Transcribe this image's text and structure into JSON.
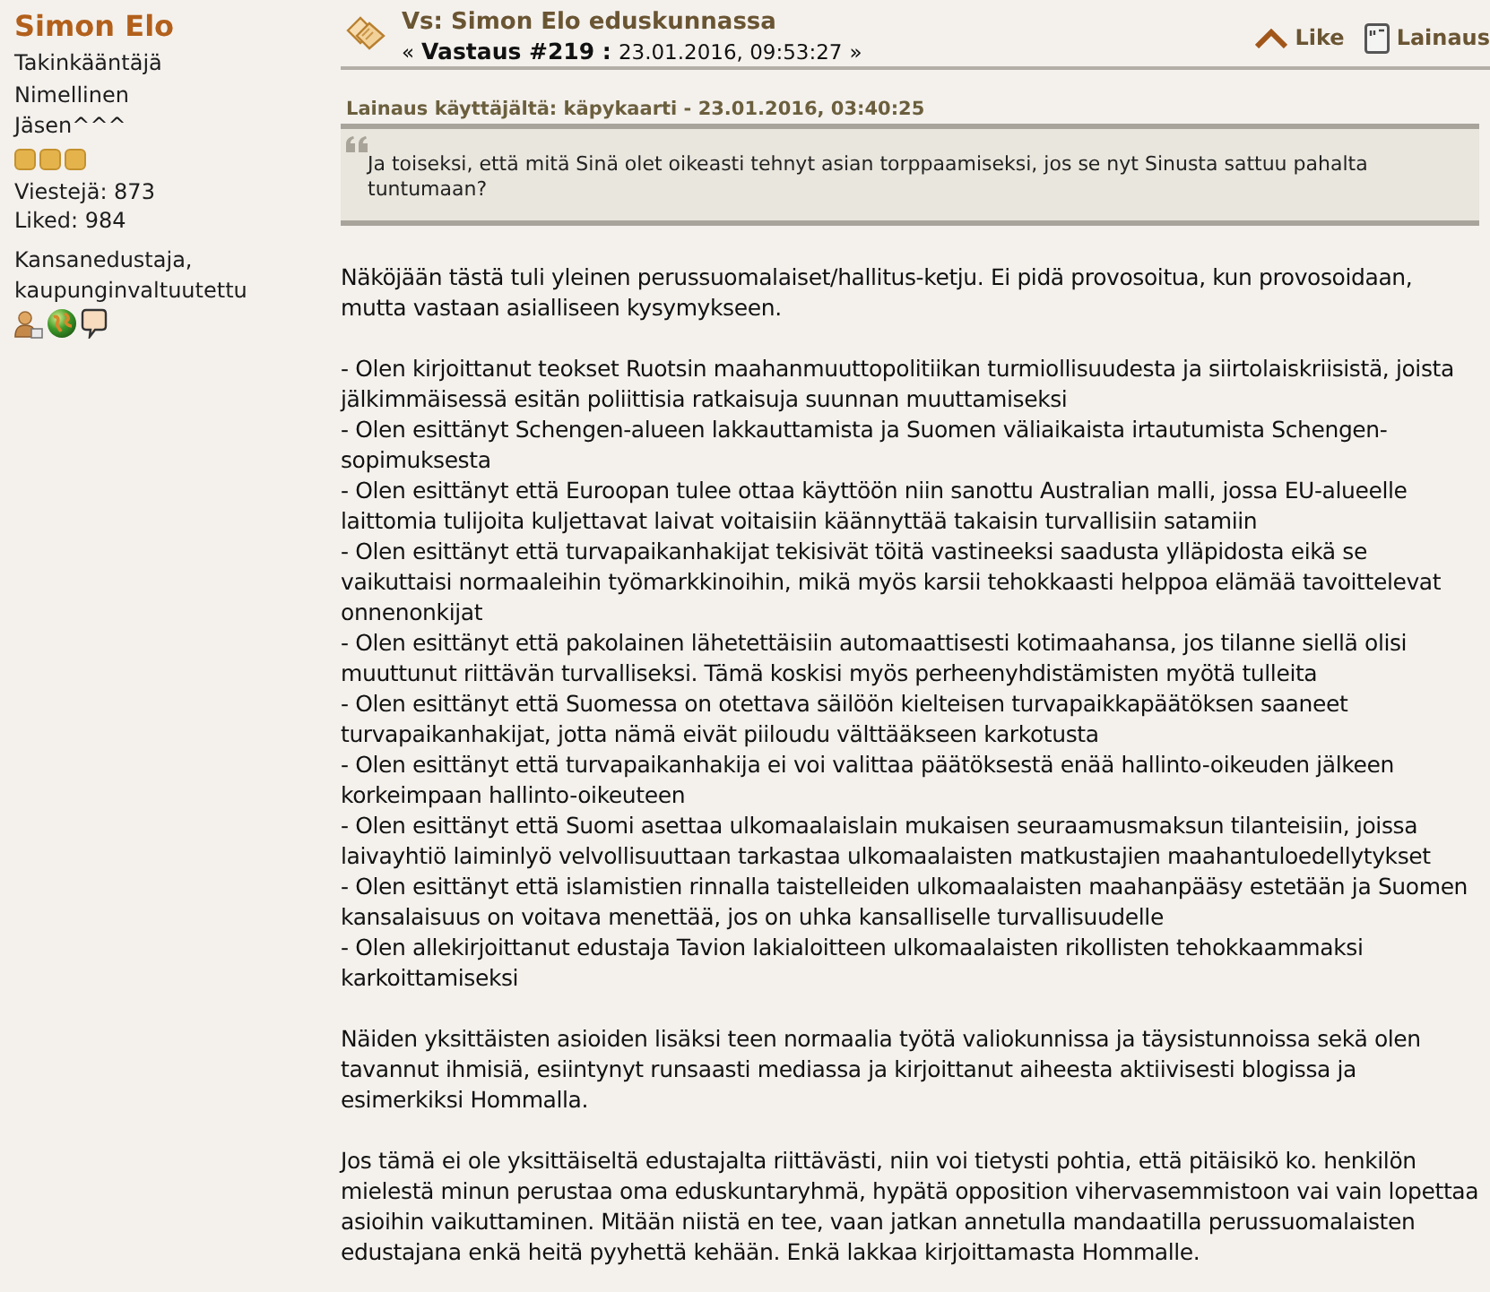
{
  "author": {
    "name": "Simon Elo",
    "titles": [
      "Takinkääntäjä",
      "Nimellinen",
      "Jäsen^^^"
    ],
    "stars": 3,
    "posts": "Viestejä: 873",
    "likes": "Liked: 984",
    "personal_text": "Kansanedustaja, kaupunginvaltuutettu"
  },
  "post": {
    "subject": "Vs: Simon Elo eduskunnassa",
    "nav_prev": "«",
    "reply_label": "Vastaus #219 :",
    "date": "23.01.2016, 09:53:27",
    "nav_next": "»",
    "actions": [
      {
        "kind": "like",
        "label": "Like"
      },
      {
        "kind": "quote",
        "label": "Lainaus"
      }
    ]
  },
  "quote": {
    "header": "Lainaus käyttäjältä: käpykaarti - 23.01.2016, 03:40:25",
    "text": "Ja toiseksi, että mitä Sinä olet oikeasti tehnyt asian torppaamiseksi, jos se nyt Sinusta sattuu pahalta tuntumaan?"
  },
  "body": [
    {
      "kind": "paragraph",
      "text": "Näköjään tästä tuli yleinen perussuomalaiset/hallitus-ketju. Ei pidä provosoitua, kun provosoidaan, mutta vastaan asialliseen kysymykseen."
    },
    {
      "kind": "list",
      "items": [
        "- Olen kirjoittanut teokset Ruotsin maahanmuuttopolitiikan turmiollisuudesta ja siirtolaiskriisistä, joista jälkimmäisessä esitän poliittisia ratkaisuja suunnan muuttamiseksi",
        "- Olen esittänyt Schengen-alueen lakkauttamista ja Suomen väliaikaista irtautumista Schengen-sopimuksesta",
        "- Olen esittänyt että Euroopan tulee ottaa käyttöön niin sanottu Australian malli, jossa EU-alueelle laittomia tulijoita kuljettavat laivat voitaisiin käännyttää takaisin turvallisiin satamiin",
        "- Olen esittänyt että turvapaikanhakijat tekisivät töitä vastineeksi saadusta ylläpidosta eikä se vaikuttaisi normaaleihin työmarkkinoihin, mikä myös karsii tehokkaasti helppoa elämää tavoittelevat onnenonkijat",
        "- Olen esittänyt että pakolainen lähetettäisiin automaattisesti kotimaahansa, jos tilanne siellä olisi muuttunut riittävän turvalliseksi. Tämä koskisi myös perheenyhdistämisten myötä tulleita",
        "- Olen esittänyt että Suomessa on otettava säilöön kielteisen turvapaikkapäätöksen saaneet turvapaikanhakijat, jotta nämä eivät piiloudu välttääkseen karkotusta",
        "- Olen esittänyt että turvapaikanhakija ei voi valittaa päätöksestä enää hallinto-oikeuden jälkeen korkeimpaan hallinto-oikeuteen",
        "- Olen esittänyt että Suomi asettaa ulkomaalaislain mukaisen seuraamusmaksun tilanteisiin, joissa laivayhtiö laiminlyö velvollisuuttaan tarkastaa ulkomaalaisten matkustajien maahantuloedellytykset",
        "- Olen esittänyt että islamistien rinnalla taistelleiden ulkomaalaisten maahanpääsy estetään ja Suomen kansalaisuus on voitava menettää, jos on uhka kansalliselle turvallisuudelle",
        "- Olen allekirjoittanut edustaja Tavion lakialoitteen ulkomaalaisten rikollisten tehokkaammaksi karkoittamiseksi"
      ]
    },
    {
      "kind": "paragraph",
      "text": "Näiden yksittäisten asioiden lisäksi teen normaalia työtä valiokunnissa ja täysistunnoissa sekä olen tavannut ihmisiä, esiintynyt runsaasti mediassa ja kirjoittanut aiheesta aktiivisesti blogissa ja esimerkiksi Hommalla."
    },
    {
      "kind": "paragraph",
      "text": "Jos tämä ei ole yksittäiseltä edustajalta riittävästi, niin voi tietysti pohtia, että pitäisikö ko. henkilön mielestä minun perustaa oma eduskuntaryhmä, hypätä opposition vihervasemmistoon vai vain lopettaa asioihin vaikuttaminen. Mitään niistä en tee, vaan jatkan annetulla mandaatilla perussuomalaisten edustajana enkä heitä pyyhettä kehään. Enkä lakkaa kirjoittamasta Hommalle."
    }
  ]
}
